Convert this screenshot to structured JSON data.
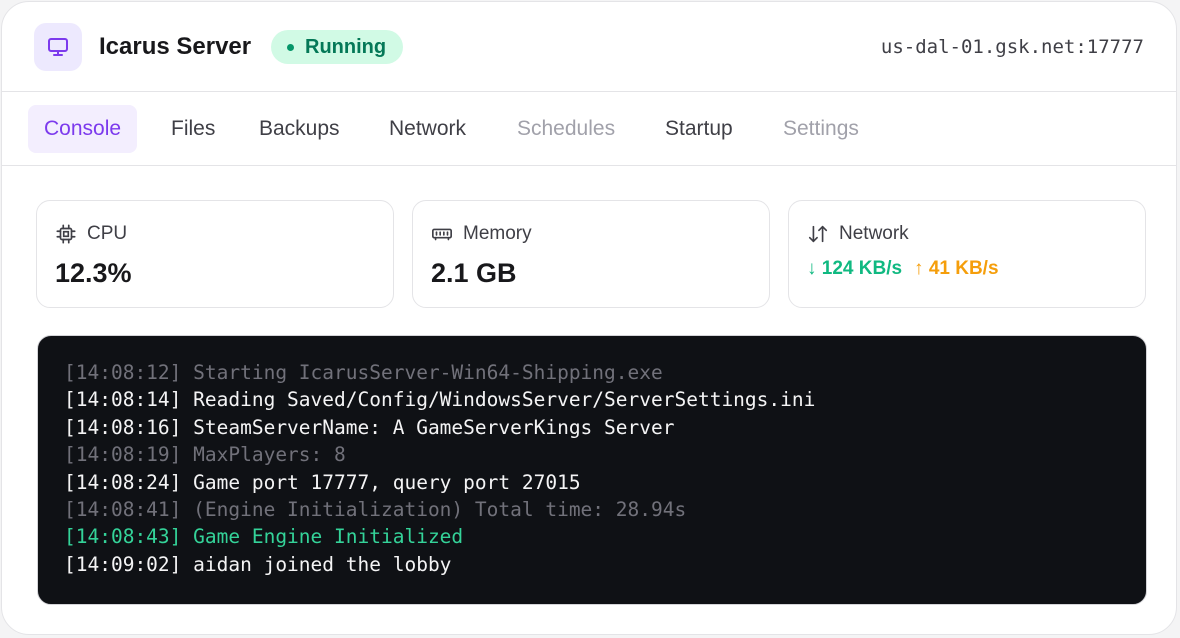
{
  "header": {
    "title": "Icarus Server",
    "status": "Running",
    "address": "us-dal-01.gsk.net:17777",
    "icon": "monitor-icon"
  },
  "tabs": [
    {
      "label": "Console",
      "state": "active"
    },
    {
      "label": "Files",
      "state": "normal"
    },
    {
      "label": "Backups",
      "state": "normal"
    },
    {
      "label": "Network",
      "state": "normal"
    },
    {
      "label": "Schedules",
      "state": "disabled"
    },
    {
      "label": "Startup",
      "state": "normal"
    },
    {
      "label": "Settings",
      "state": "disabled"
    }
  ],
  "stats": {
    "cpu": {
      "label": "CPU",
      "value": "12.3%",
      "icon": "cpu-chip-icon"
    },
    "memory": {
      "label": "Memory",
      "value": "2.1 GB",
      "icon": "memory-icon"
    },
    "network": {
      "label": "Network",
      "down": "↓ 124 KB/s",
      "up": "↑ 41 KB/s",
      "icon": "arrows-up-down-icon"
    }
  },
  "console": {
    "lines": [
      {
        "text": "[14:08:12] Starting IcarusServer-Win64-Shipping.exe",
        "style": "dim"
      },
      {
        "text": "[14:08:14] Reading Saved/Config/WindowsServer/ServerSettings.ini",
        "style": "normal"
      },
      {
        "text": "[14:08:16] SteamServerName: A GameServerKings Server",
        "style": "normal"
      },
      {
        "text": "[14:08:19] MaxPlayers: 8",
        "style": "dim"
      },
      {
        "text": "[14:08:24] Game port 17777, query port 27015",
        "style": "normal"
      },
      {
        "text": "[14:08:41] (Engine Initialization) Total time: 28.94s",
        "style": "dim"
      },
      {
        "text": "[14:08:43] Game Engine Initialized",
        "style": "success"
      },
      {
        "text": "[14:09:02] aidan joined the lobby",
        "style": "normal"
      }
    ]
  },
  "colors": {
    "accent": "#7c3aed",
    "status_bg": "#d1fae5",
    "status_text": "#047857",
    "download": "#10b981",
    "upload": "#f59e0b",
    "console_bg": "#0f1115"
  }
}
